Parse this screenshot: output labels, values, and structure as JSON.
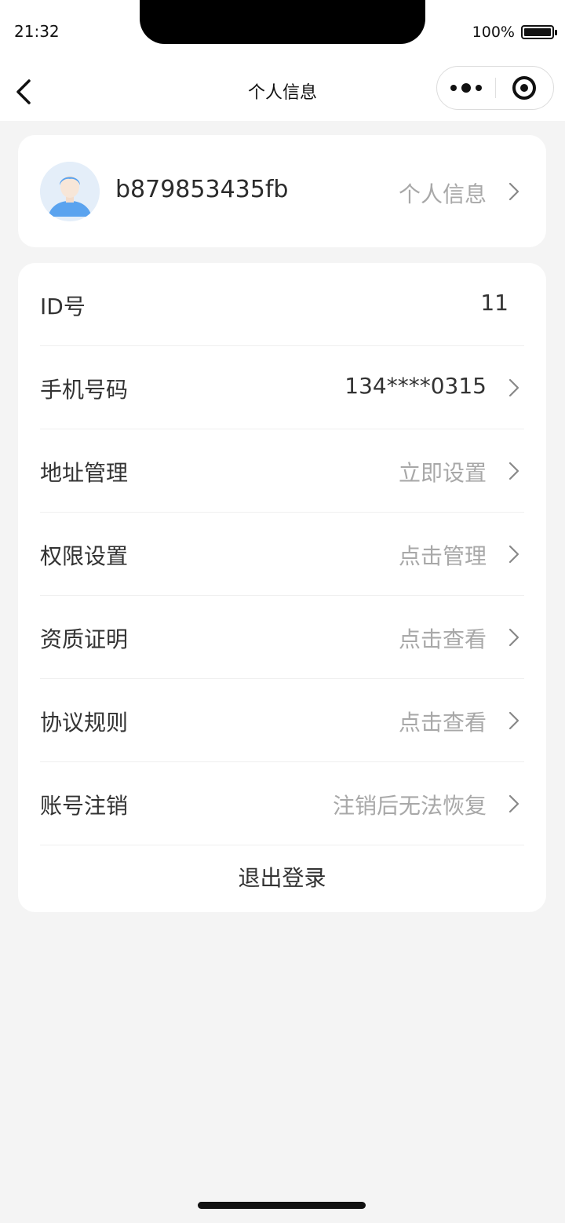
{
  "status_bar": {
    "time": "21:32",
    "battery": "100%"
  },
  "nav": {
    "title": "个人信息",
    "back_icon": "chevron-left-icon",
    "menu_icon": "more-dots-icon",
    "close_icon": "target-circle-icon"
  },
  "profile": {
    "username": "b879853435fb",
    "link_label": "个人信息"
  },
  "rows": [
    {
      "label": "ID号",
      "value": "11"
    },
    {
      "label": "手机号码",
      "value": "134****0315"
    },
    {
      "label": "地址管理",
      "value": "立即设置"
    },
    {
      "label": "权限设置",
      "value": "点击管理"
    },
    {
      "label": "资质证明",
      "value": "点击查看"
    },
    {
      "label": "协议规则",
      "value": "点击查看"
    },
    {
      "label": "账号注销",
      "value": "注销后无法恢复"
    }
  ],
  "logout_label": "退出登录",
  "colors": {
    "background": "#f4f4f4",
    "card": "#ffffff",
    "muted_text": "#a8a8a8",
    "primary_text": "#333333",
    "avatar_blue": "#5aa3ef"
  }
}
